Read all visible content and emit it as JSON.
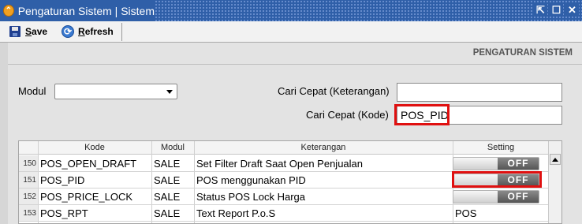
{
  "window": {
    "title": "Pengaturan Sistem | Sistem"
  },
  "toolbar": {
    "save_label_u": "S",
    "save_label_rest": "ave",
    "refresh_label_u": "R",
    "refresh_label_rest": "efresh"
  },
  "section": {
    "title": "PENGATURAN SISTEM"
  },
  "filters": {
    "modul_label": "Modul",
    "modul_value": "",
    "cari_keterangan_label": "Cari Cepat (Keterangan)",
    "cari_keterangan_value": "",
    "cari_kode_label": "Cari Cepat (Kode)",
    "cari_kode_value": "POS_PID"
  },
  "grid": {
    "columns": [
      "Kode",
      "Modul",
      "Keterangan",
      "Setting"
    ],
    "rows": [
      {
        "num": "150",
        "kode": "POS_OPEN_DRAFT",
        "modul": "SALE",
        "keterangan": "Set Filter Draft Saat Open Penjualan",
        "setting": "OFF",
        "setting_type": "toggle"
      },
      {
        "num": "151",
        "kode": "POS_PID",
        "modul": "SALE",
        "keterangan": "POS menggunakan PID",
        "setting": "OFF",
        "setting_type": "toggle"
      },
      {
        "num": "152",
        "kode": "POS_PRICE_LOCK",
        "modul": "SALE",
        "keterangan": "Status POS Lock Harga",
        "setting": "OFF",
        "setting_type": "toggle"
      },
      {
        "num": "153",
        "kode": "POS_RPT",
        "modul": "SALE",
        "keterangan": "Text Report P.o.S",
        "setting": "POS",
        "setting_type": "text"
      }
    ]
  },
  "colors": {
    "titlebar": "#2f5fa8",
    "highlight": "#e01010"
  }
}
